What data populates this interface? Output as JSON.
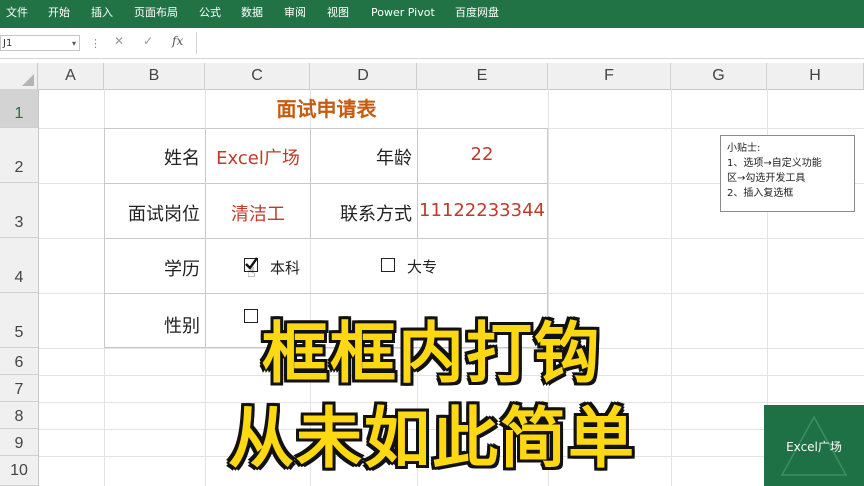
{
  "ribbon": {
    "tabs": [
      "文件",
      "开始",
      "插入",
      "页面布局",
      "公式",
      "数据",
      "审阅",
      "视图",
      "Power Pivot",
      "百度网盘"
    ]
  },
  "formula_bar": {
    "name_box": "J1",
    "fx": "fx",
    "cancel_icon": "close-icon",
    "enter_icon": "check-icon"
  },
  "grid": {
    "columns": [
      "A",
      "B",
      "C",
      "D",
      "E",
      "F",
      "G",
      "H"
    ],
    "rows": [
      "1",
      "2",
      "3",
      "4",
      "5",
      "6",
      "7",
      "8",
      "9",
      "10"
    ]
  },
  "form": {
    "title": "面试申请表",
    "name_label": "姓名",
    "name_value": "Excel广场",
    "age_label": "年龄",
    "age_value": "22",
    "position_label": "面试岗位",
    "position_value": "清洁工",
    "contact_label": "联系方式",
    "contact_value": "11122233344",
    "education_label": "学历",
    "education_options": [
      {
        "label": "本科",
        "checked": true
      },
      {
        "label": "大专",
        "checked": false
      }
    ],
    "gender_label": "性别"
  },
  "tip": {
    "lines": [
      "小贴士:",
      "1、选项→自定义功能",
      "区→勾选开发工具",
      "2、插入复选框"
    ]
  },
  "caption": {
    "line1": "框框内打钩",
    "line2": "从未如此简单"
  },
  "logo": {
    "text": "Excel广场"
  },
  "colors": {
    "ribbon": "#217346",
    "title": "#c55a11",
    "value": "#c0392b",
    "caption": "#ffd814"
  }
}
